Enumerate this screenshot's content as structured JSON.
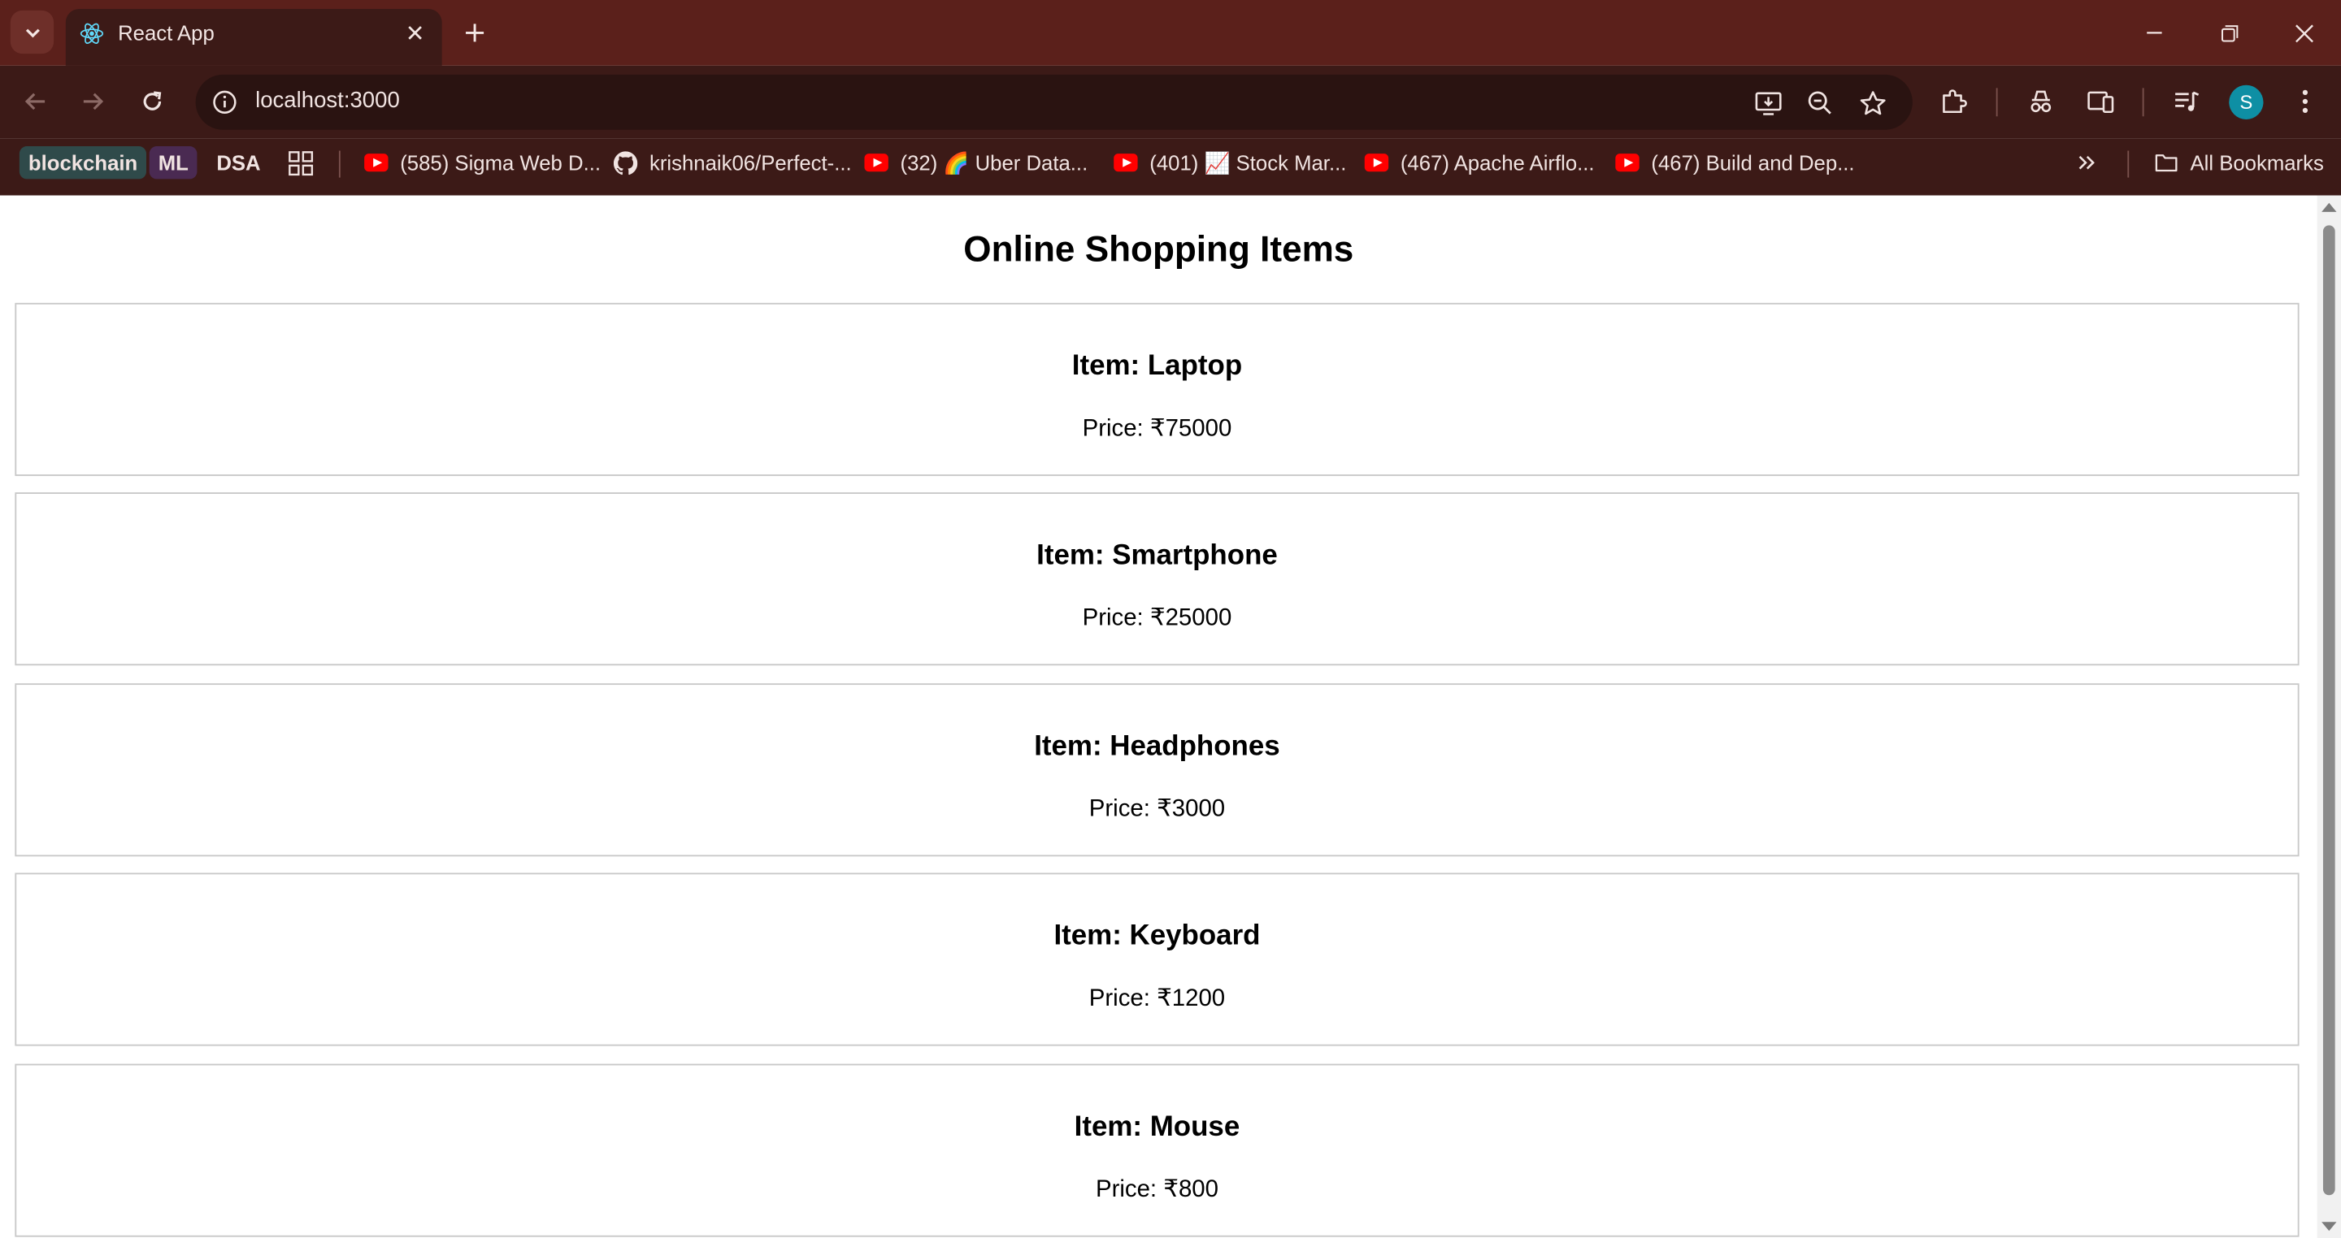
{
  "browser": {
    "tab": {
      "title": "React App",
      "favicon": "react-logo-icon"
    },
    "address_bar": {
      "url": "localhost:3000"
    },
    "avatar_initial": "S",
    "colors": {
      "frame": "#5b201b",
      "toolbar": "#3c1a17",
      "avatar": "#0e8fa4"
    },
    "bookmarks": {
      "chips": [
        "blockchain",
        "ML",
        "DSA"
      ],
      "items": [
        {
          "icon": "youtube-icon",
          "label": "(585) Sigma Web D..."
        },
        {
          "icon": "github-icon",
          "label": "krishnaik06/Perfect-..."
        },
        {
          "icon": "youtube-icon",
          "label": "(32) 🌈 Uber Data..."
        },
        {
          "icon": "youtube-icon",
          "label": "(401) 📈 Stock Mar..."
        },
        {
          "icon": "youtube-icon",
          "label": "(467) Apache Airflo..."
        },
        {
          "icon": "youtube-icon",
          "label": "(467) Build and Dep..."
        }
      ],
      "all_bookmarks": "All Bookmarks"
    }
  },
  "page": {
    "heading": "Online Shopping Items",
    "items": [
      {
        "name": "Item: Laptop",
        "price": "Price: ₹75000"
      },
      {
        "name": "Item: Smartphone",
        "price": "Price: ₹25000"
      },
      {
        "name": "Item: Headphones",
        "price": "Price: ₹3000"
      },
      {
        "name": "Item: Keyboard",
        "price": "Price: ₹1200"
      },
      {
        "name": "Item: Mouse",
        "price": "Price: ₹800"
      }
    ]
  }
}
